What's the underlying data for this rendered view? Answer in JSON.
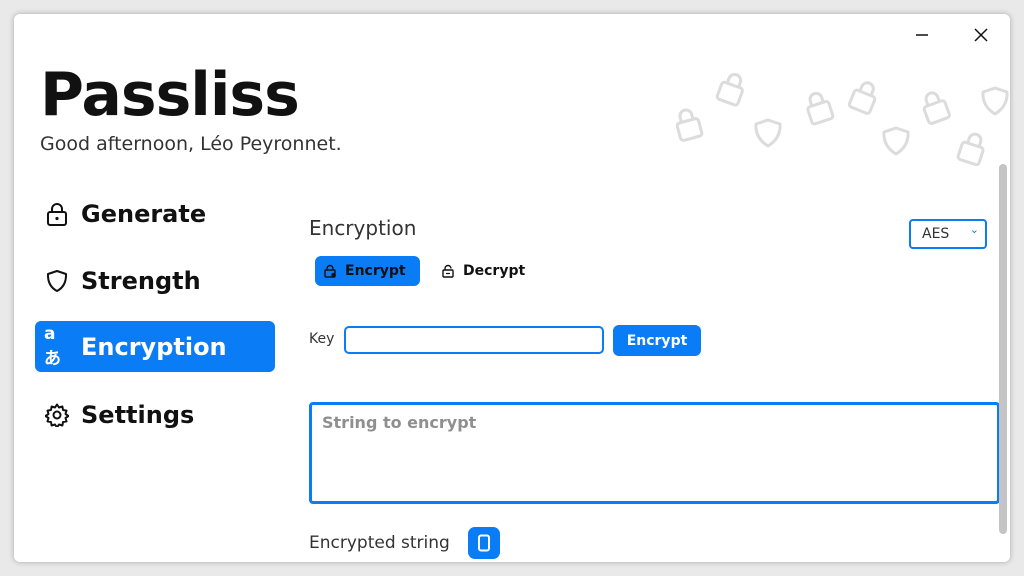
{
  "app": {
    "title": "Passliss",
    "greeting": "Good afternoon, Léo Peyronnet."
  },
  "window_controls": {
    "minimize_icon": "minimize-icon",
    "close_icon": "close-icon"
  },
  "sidebar": {
    "items": [
      {
        "label": "Generate",
        "icon": "lock-icon",
        "active": false
      },
      {
        "label": "Strength",
        "icon": "shield-icon",
        "active": false
      },
      {
        "label": "Encryption",
        "icon": "translate-icon",
        "glyph": "aあ",
        "active": true
      },
      {
        "label": "Settings",
        "icon": "gear-icon",
        "active": false
      }
    ]
  },
  "main": {
    "section_title": "Encryption",
    "algorithm": {
      "selected": "AES"
    },
    "mode_tabs": [
      {
        "label": "Encrypt",
        "icon": "lock-icon",
        "active": true
      },
      {
        "label": "Decrypt",
        "icon": "unlock-icon",
        "active": false
      }
    ],
    "key": {
      "label": "Key",
      "value": "",
      "placeholder": ""
    },
    "encrypt_button": "Encrypt",
    "input": {
      "placeholder": "String to encrypt",
      "value": ""
    },
    "output_label": "Encrypted string",
    "copy_icon": "copy-icon"
  },
  "colors": {
    "accent": "#0a7cf5",
    "text": "#111111",
    "muted": "#8f8f8f"
  }
}
